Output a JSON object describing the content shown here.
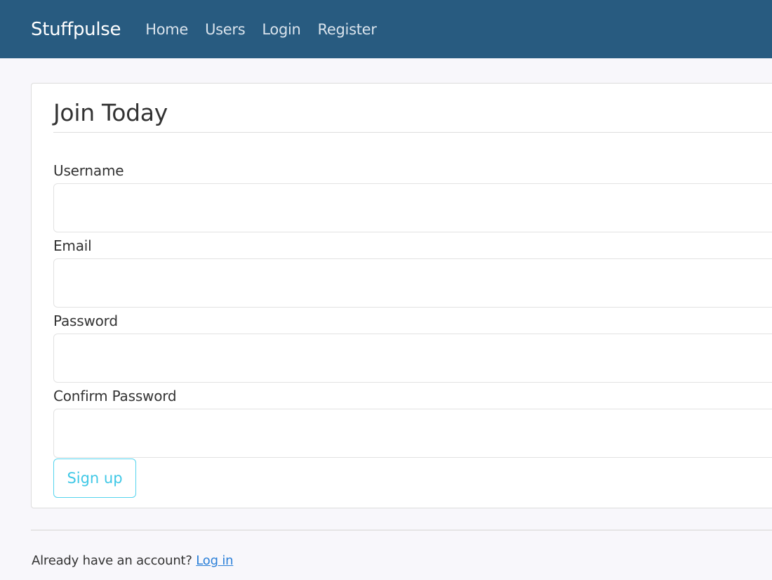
{
  "navbar": {
    "brand": "Stuffpulse",
    "links": [
      {
        "label": "Home"
      },
      {
        "label": "Users"
      },
      {
        "label": "Login"
      },
      {
        "label": "Register"
      }
    ]
  },
  "form": {
    "legend": "Join Today",
    "fields": [
      {
        "label": "Username",
        "value": ""
      },
      {
        "label": "Email",
        "value": ""
      },
      {
        "label": "Password",
        "value": ""
      },
      {
        "label": "Confirm Password",
        "value": ""
      }
    ],
    "submit_label": "Sign up"
  },
  "footer": {
    "prompt": "Already have an account?",
    "link_label": "Log in"
  },
  "colors": {
    "navbar_bg": "#285b80",
    "page_bg": "#f8f7fb",
    "button_accent": "#40c8e6",
    "link": "#2a7fd8"
  }
}
